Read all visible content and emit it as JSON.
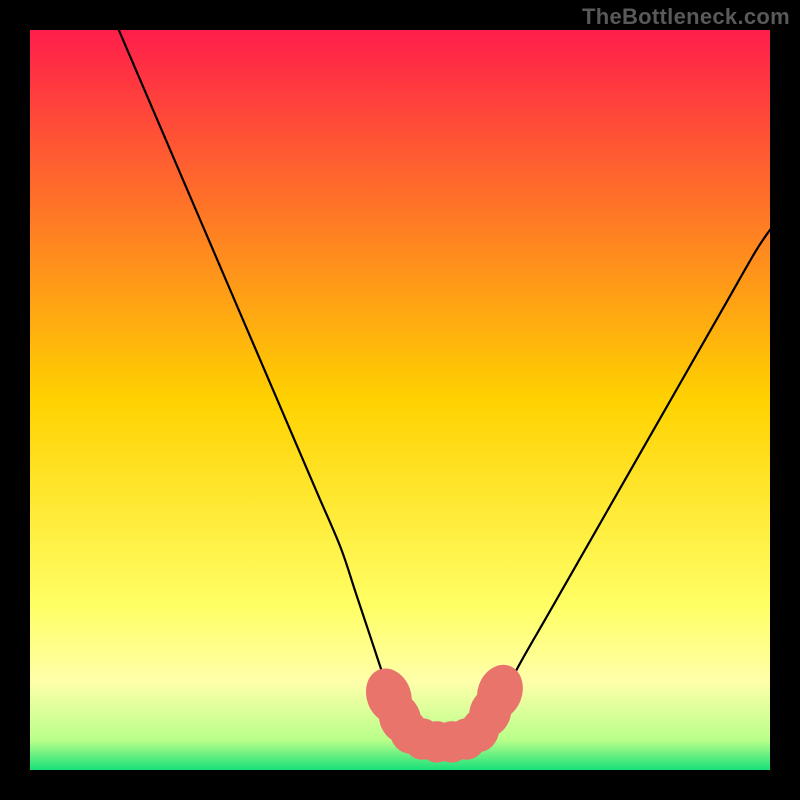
{
  "watermark": "TheBottleneck.com",
  "chart_data": {
    "type": "line",
    "title": "",
    "xlabel": "",
    "ylabel": "",
    "xlim": [
      0,
      100
    ],
    "ylim": [
      0,
      100
    ],
    "grid": false,
    "legend": false,
    "background_gradient": {
      "direction": "vertical",
      "stops": [
        {
          "offset": 0.0,
          "color": "#ff1e4b"
        },
        {
          "offset": 0.5,
          "color": "#ffd200"
        },
        {
          "offset": 0.78,
          "color": "#ffff66"
        },
        {
          "offset": 0.88,
          "color": "#ffffaa"
        },
        {
          "offset": 0.96,
          "color": "#b8ff8a"
        },
        {
          "offset": 1.0,
          "color": "#18e07a"
        }
      ]
    },
    "series": [
      {
        "name": "left-curve",
        "x": [
          12,
          15,
          18,
          21,
          24,
          27,
          30,
          33,
          36,
          39,
          42,
          44,
          46,
          48,
          49.5,
          51
        ],
        "y": [
          100,
          93,
          86,
          79,
          72,
          65,
          58,
          51,
          44,
          37,
          30,
          24,
          18,
          12,
          8,
          5
        ]
      },
      {
        "name": "right-curve",
        "x": [
          61,
          63,
          66,
          70,
          74,
          78,
          82,
          86,
          90,
          94,
          98,
          100
        ],
        "y": [
          5,
          8,
          14,
          21,
          28,
          35,
          42,
          49,
          56,
          63,
          70,
          73
        ]
      },
      {
        "name": "flat-bottom",
        "x": [
          51,
          53,
          55.5,
          58,
          61
        ],
        "y": [
          5,
          4.5,
          4.3,
          4.5,
          5
        ]
      }
    ],
    "markers": {
      "name": "bottom-markers",
      "color": "#e8746b",
      "points": [
        {
          "x": 48.5,
          "y": 10,
          "rx": 3.0,
          "ry": 3.8,
          "rot": -20
        },
        {
          "x": 50.0,
          "y": 7.0,
          "rx": 2.8,
          "ry": 3.4,
          "rot": -18
        },
        {
          "x": 51.2,
          "y": 5.2,
          "rx": 2.6,
          "ry": 3.0,
          "rot": -12
        },
        {
          "x": 53.0,
          "y": 4.2,
          "rx": 2.6,
          "ry": 2.8,
          "rot": 0
        },
        {
          "x": 55.0,
          "y": 3.8,
          "rx": 2.6,
          "ry": 2.8,
          "rot": 0
        },
        {
          "x": 57.0,
          "y": 3.8,
          "rx": 2.6,
          "ry": 2.8,
          "rot": 0
        },
        {
          "x": 59.0,
          "y": 4.2,
          "rx": 2.6,
          "ry": 2.8,
          "rot": 0
        },
        {
          "x": 60.8,
          "y": 5.4,
          "rx": 2.6,
          "ry": 3.0,
          "rot": 14
        },
        {
          "x": 62.2,
          "y": 7.8,
          "rx": 2.8,
          "ry": 3.4,
          "rot": 18
        },
        {
          "x": 63.5,
          "y": 10.5,
          "rx": 3.0,
          "ry": 3.8,
          "rot": 20
        }
      ]
    }
  }
}
